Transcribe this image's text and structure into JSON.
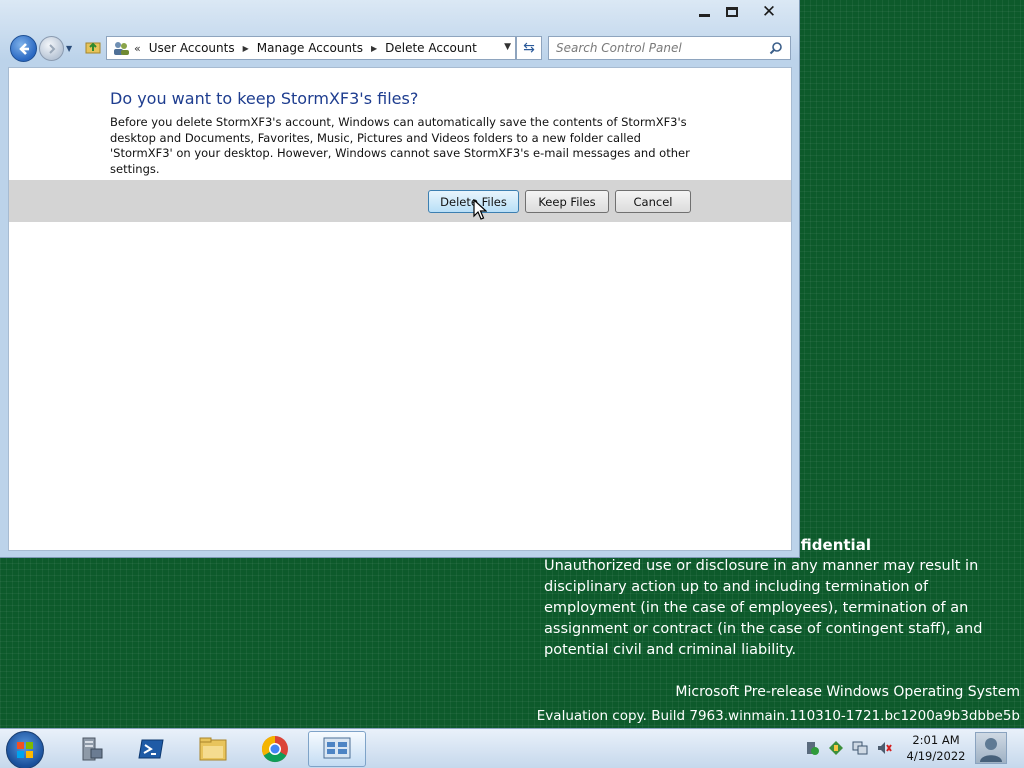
{
  "window": {
    "address": {
      "crumbs": [
        "User Accounts",
        "Manage Accounts",
        "Delete Account"
      ]
    },
    "search": {
      "placeholder": "Search Control Panel"
    }
  },
  "dialog": {
    "heading": "Do you want to keep StormXF3's files?",
    "description": "Before you delete StormXF3's account, Windows can automatically save the contents of StormXF3's desktop and Documents, Favorites, Music, Pictures and Videos folders to a new folder called 'StormXF3' on your desktop. However, Windows cannot save StormXF3's e-mail messages and other settings.",
    "buttons": {
      "delete": "Delete Files",
      "keep": "Keep Files",
      "cancel": "Cancel"
    }
  },
  "desktop": {
    "watermark_title": "nfidential",
    "watermark_body": "Unauthorized use or disclosure in any manner may result in disciplinary action up to and including termination of employment (in the case of employees), termination of an assignment or contract (in the case of contingent staff), and potential civil and criminal liability.",
    "os_line": "Microsoft Pre-release Windows Operating System",
    "build_line": "Evaluation copy. Build 7963.winmain.110310-1721.bc1200a9b3dbbe5b"
  },
  "taskbar": {
    "apps": [
      "server-manager-icon",
      "powershell-icon",
      "file-explorer-icon",
      "chrome-icon",
      "control-panel-icon"
    ],
    "clock": {
      "time": "2:01 AM",
      "date": "4/19/2022"
    }
  }
}
